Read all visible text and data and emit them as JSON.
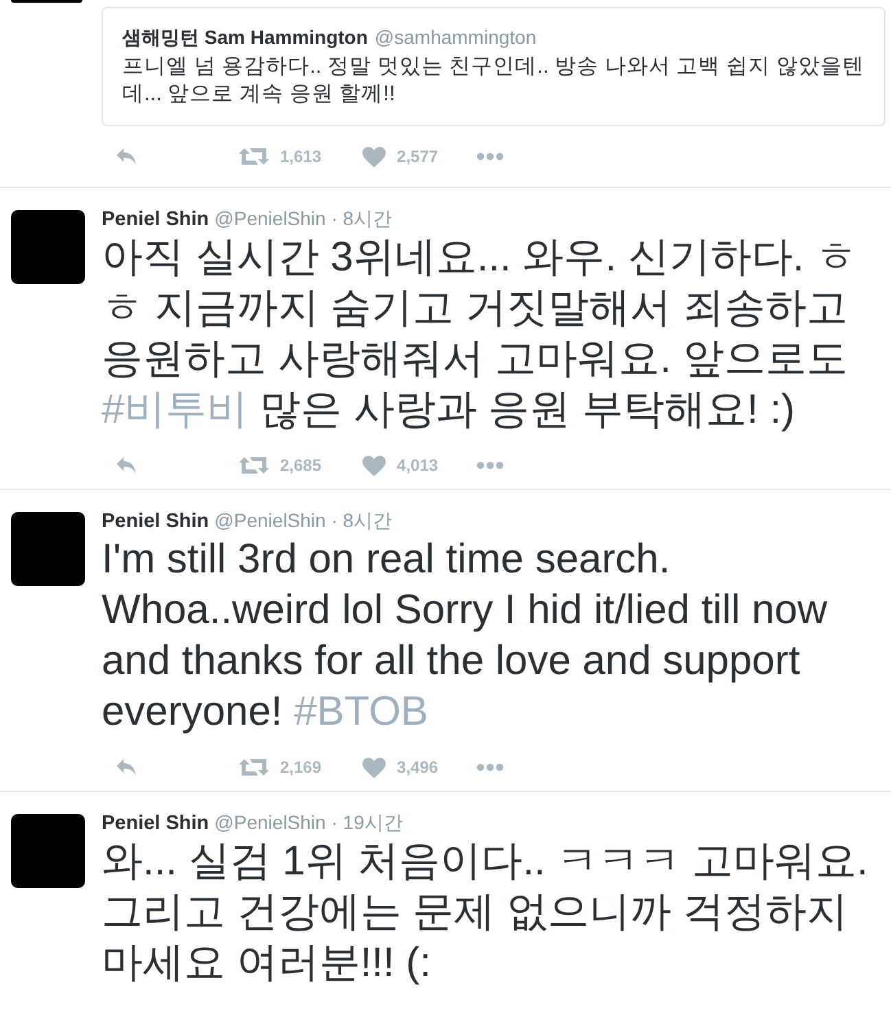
{
  "quote_tweet": {
    "name_korean": "샘해밍턴",
    "name": "Sam Hammington",
    "handle": "@samhammington",
    "text": "프니엘 넘 용감하다.. 정말 멋있는 친구인데.. 방송 나와서 고백 쉽지 않았을텐데... 앞으로 계속 응원 할께!!",
    "retweets": "1,613",
    "likes": "2,577"
  },
  "tweets": [
    {
      "name": "Peniel Shin",
      "handle": "@PenielShin",
      "separator": "·",
      "time": "8시간",
      "body": [
        {
          "kind": "text",
          "text": "아직 실시간 3위네요... 와우. 신기하다. ㅎㅎ 지금까지 숨기고 거짓말해서 죄송하고 응원하고 사랑해줘서 고마워요. 앞으로도 "
        },
        {
          "kind": "hashtag",
          "text": "#비투비"
        },
        {
          "kind": "text",
          "text": " 많은 사랑과 응원 부탁해요! :)"
        }
      ],
      "retweets": "2,685",
      "likes": "4,013"
    },
    {
      "name": "Peniel Shin",
      "handle": "@PenielShin",
      "separator": "·",
      "time": "8시간",
      "body": [
        {
          "kind": "text",
          "text": "I'm still 3rd on real time search. Whoa..weird lol Sorry I hid it/lied till now and thanks for all the love and support everyone! "
        },
        {
          "kind": "hashtag",
          "text": "#BTOB"
        }
      ],
      "retweets": "2,169",
      "likes": "3,496"
    },
    {
      "name": "Peniel Shin",
      "handle": "@PenielShin",
      "separator": "·",
      "time": "19시간",
      "body": [
        {
          "kind": "text",
          "text": "와... 실검 1위 처음이다.. ㅋㅋㅋ 고마워요. 그리고 건강에는 문제 없으니까 걱정하지마세요 여러분!!! (:"
        }
      ]
    }
  ]
}
